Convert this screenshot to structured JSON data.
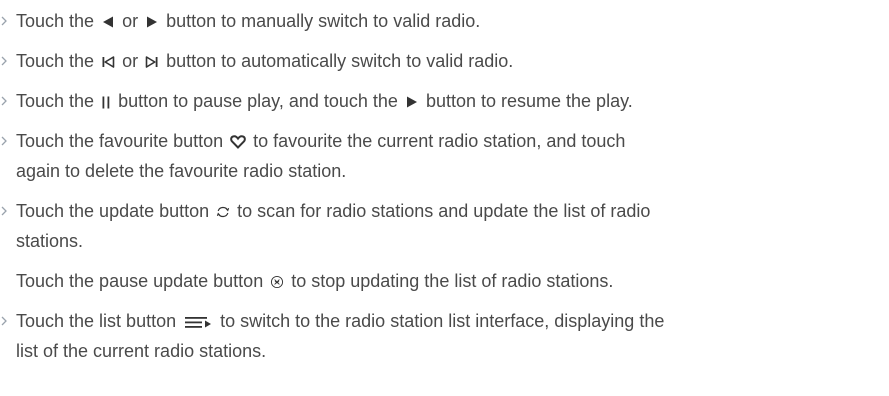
{
  "colors": {
    "text": "#4a4a4a",
    "bullet": "#9aa3ad",
    "icon": "#333333"
  },
  "icons": {
    "bullet": "chevron-right-icon",
    "prev": "triangle-left-icon",
    "next": "triangle-right-icon",
    "seek_prev": "skip-previous-icon",
    "seek_next": "skip-next-icon",
    "pause": "pause-icon",
    "play": "play-icon",
    "favourite": "heart-icon",
    "update": "refresh-icon",
    "pause_update": "pause-update-icon",
    "list": "list-icon"
  },
  "items": [
    {
      "p1": "Touch the ",
      "p2": " or ",
      "p3": " button to manually switch to valid radio."
    },
    {
      "p1": "Touch the ",
      "p2": " or ",
      "p3": " button to automatically switch to valid radio."
    },
    {
      "p1": "Touch the ",
      "p2": " button to pause play, and touch the ",
      "p3": " button to resume the play."
    },
    {
      "p1": "Touch the favourite button ",
      "p2": " to favourite the current radio station, and touch",
      "line2": "again to delete the favourite radio station."
    },
    {
      "p1": "Touch the update button ",
      "p2": " to scan for radio stations and update the list of radio",
      "line2": "stations.",
      "sub1": "Touch the pause update button ",
      "sub2": " to stop updating the list of radio stations."
    },
    {
      "p1": "Touch the list button ",
      "p2": " to switch to the radio station list interface, displaying the",
      "line2": "list of the current radio stations."
    }
  ]
}
